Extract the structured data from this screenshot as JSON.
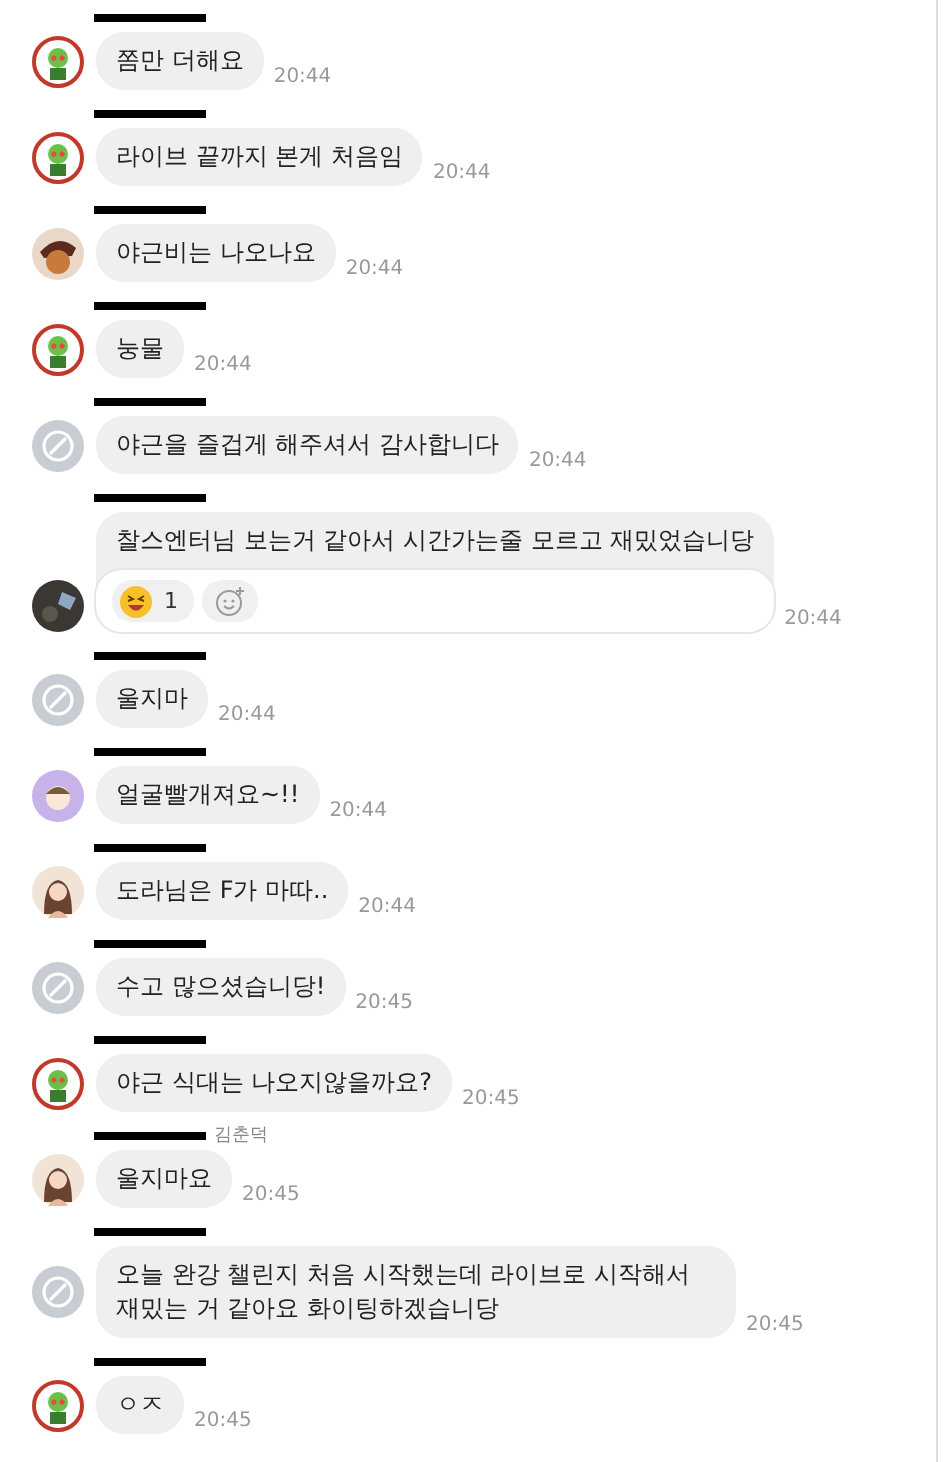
{
  "messages": [
    {
      "avatar": {
        "kind": "mascot"
      },
      "name_redacted": true,
      "text": "쫌만 더해요",
      "time": "20:44"
    },
    {
      "avatar": {
        "kind": "mascot"
      },
      "name_redacted": true,
      "text": "라이브 끝까지 본게 처음임",
      "time": "20:44"
    },
    {
      "avatar": {
        "kind": "cartoon"
      },
      "name_redacted": true,
      "text": "야근비는 나오나요",
      "time": "20:44"
    },
    {
      "avatar": {
        "kind": "mascot"
      },
      "name_redacted": true,
      "text": "눙물",
      "time": "20:44"
    },
    {
      "avatar": {
        "kind": "default"
      },
      "name_redacted": true,
      "text": "야근을 즐겁게 해주셔서 감사합니다",
      "time": "20:44"
    },
    {
      "avatar": {
        "kind": "dark"
      },
      "name_redacted": true,
      "text": "찰스엔터님 보는거 같아서 시간가는줄 모르고 재밌었습니당",
      "time": "20:44",
      "reactions": [
        {
          "count": "1"
        }
      ],
      "add_reaction": true
    },
    {
      "avatar": {
        "kind": "default"
      },
      "name_redacted": true,
      "text": "울지마",
      "time": "20:44"
    },
    {
      "avatar": {
        "kind": "lavender"
      },
      "name_redacted": true,
      "text": "얼굴빨개져요~!!",
      "time": "20:44"
    },
    {
      "avatar": {
        "kind": "person"
      },
      "name_redacted": true,
      "text": "도라님은 F가 마따..",
      "time": "20:44"
    },
    {
      "avatar": {
        "kind": "default"
      },
      "name_redacted": true,
      "text": "수고 많으셨습니당!",
      "time": "20:45"
    },
    {
      "avatar": {
        "kind": "mascot"
      },
      "name_redacted": true,
      "text": "야근 식대는 나오지않을까요?",
      "time": "20:45"
    },
    {
      "avatar": {
        "kind": "person"
      },
      "name_redacted": true,
      "name": "김춘덕",
      "text": "울지마요",
      "time": "20:45"
    },
    {
      "avatar": {
        "kind": "default"
      },
      "name_redacted": true,
      "text": "오늘 완강 챌린지 처음 시작했는데 라이브로 시작해서 재밌는 거 같아요 화이팅하겠습니당",
      "time": "20:45"
    },
    {
      "avatar": {
        "kind": "mascot"
      },
      "name_redacted": true,
      "text": "ㅇㅈ",
      "time": "20:45"
    }
  ]
}
